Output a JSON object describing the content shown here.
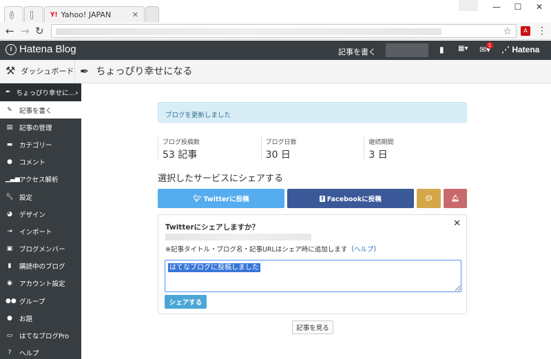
{
  "browser": {
    "tabs": [
      {
        "title": "",
        "icon": "hatena-favicon"
      },
      {
        "title": "",
        "icon": "page-icon"
      },
      {
        "title": "Yahoo! JAPAN",
        "icon": "yahoo-favicon"
      }
    ],
    "window_controls": [
      "—",
      "☐",
      "✕"
    ]
  },
  "header": {
    "logo": "Hatena Blog",
    "write_article": "記事を書く",
    "notification_count": "1",
    "brand": "Hatena"
  },
  "subheader": {
    "dashboard": "ダッシュボード",
    "blog_title": "ちょっぴり幸せになる"
  },
  "sidebar": {
    "items": [
      {
        "label": "ちょっぴり幸せに…",
        "icon": "pen-icon"
      },
      {
        "label": "記事を書く",
        "icon": "edit-icon"
      },
      {
        "label": "記事の管理",
        "icon": "document-icon"
      },
      {
        "label": "カテゴリー",
        "icon": "folder-icon"
      },
      {
        "label": "コメント",
        "icon": "comment-icon"
      },
      {
        "label": "アクセス解析",
        "icon": "chart-icon"
      },
      {
        "label": "設定",
        "icon": "wrench-icon"
      },
      {
        "label": "デザイン",
        "icon": "palette-icon"
      },
      {
        "label": "インポート",
        "icon": "import-icon"
      },
      {
        "label": "ブログメンバー",
        "icon": "members-icon"
      },
      {
        "label": "購読中のブログ",
        "icon": "bookmark-icon"
      },
      {
        "label": "アカウント設定",
        "icon": "account-icon"
      },
      {
        "label": "グループ",
        "icon": "group-icon"
      },
      {
        "label": "お題",
        "icon": "topic-icon"
      },
      {
        "label": "はてなブログPro",
        "icon": "pro-icon"
      },
      {
        "label": "ヘルプ",
        "icon": "help-icon"
      }
    ]
  },
  "main": {
    "alert": "ブログを更新しました",
    "stats": [
      {
        "label": "ブログ投稿数",
        "value": "53 記事"
      },
      {
        "label": "ブログ日数",
        "value": "30 日"
      },
      {
        "label": "継続期間",
        "value": "3 日"
      }
    ],
    "share_title": "選択したサービスにシェアする",
    "share_buttons": {
      "twitter": "Twitterに投稿",
      "facebook": "Facebookに投稿"
    },
    "panel": {
      "title": "Twitterにシェアしますか？",
      "note": "※記事タイトル・ブログ名・記事URLはシェア時に追加します",
      "help_link": "ヘルプ",
      "textarea_value": "はてなブログに投稿しました",
      "submit": "シェアする"
    },
    "view_article": "記事を見る"
  },
  "colors": {
    "header_bg": "#383d41",
    "alert_bg": "#d9edf7",
    "twitter": "#55acee",
    "facebook": "#3b5998",
    "comment_btn": "#d4a84a",
    "pin_btn": "#c96a6a",
    "submit": "#4ba6d6"
  }
}
